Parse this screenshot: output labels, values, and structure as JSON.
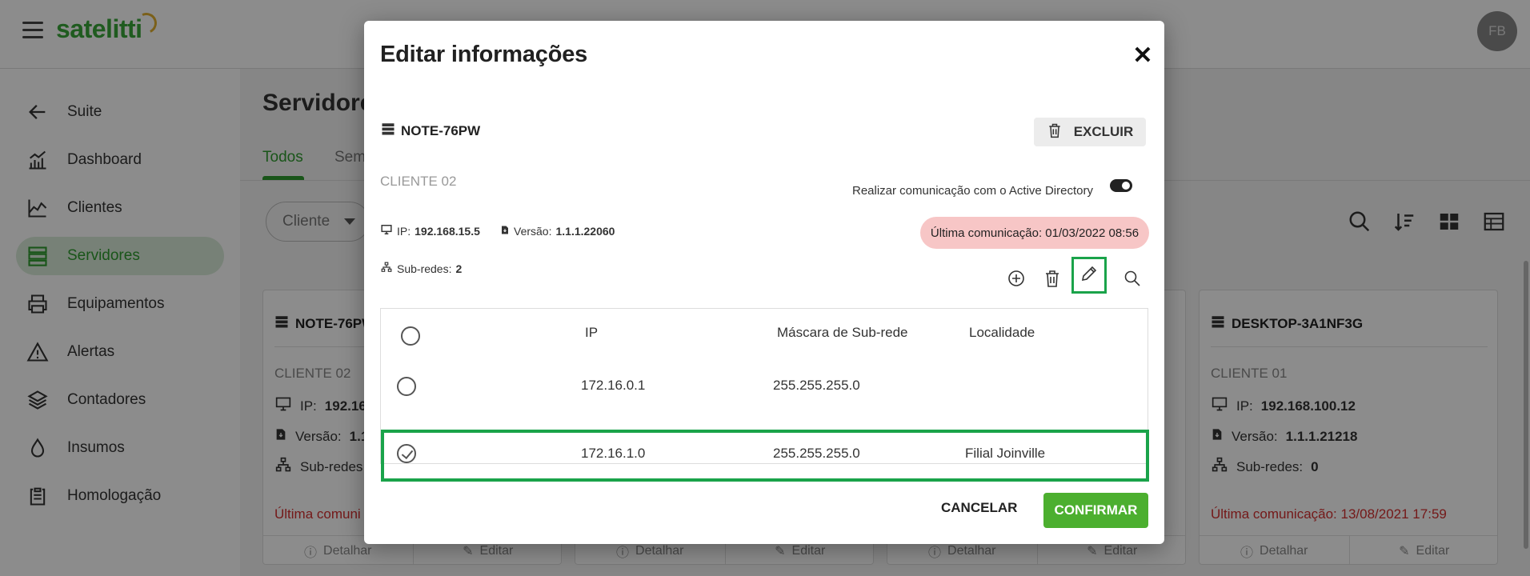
{
  "app": {
    "logo": "satelitti",
    "avatar_initials": "FB"
  },
  "sidebar": {
    "items": [
      {
        "label": "Suite",
        "icon": "arrow-left-icon"
      },
      {
        "label": "Dashboard",
        "icon": "dashboard-icon"
      },
      {
        "label": "Clientes",
        "icon": "chart-icon"
      },
      {
        "label": "Servidores",
        "icon": "server-icon",
        "active": true
      },
      {
        "label": "Equipamentos",
        "icon": "printer-icon"
      },
      {
        "label": "Alertas",
        "icon": "warning-icon"
      },
      {
        "label": "Contadores",
        "icon": "layers-icon"
      },
      {
        "label": "Insumos",
        "icon": "drop-icon"
      },
      {
        "label": "Homologação",
        "icon": "clipboard-icon"
      }
    ]
  },
  "main": {
    "title": "Servidore",
    "tabs": [
      "Todos",
      "Sem"
    ],
    "filter": {
      "label": "Cliente"
    },
    "cards": [
      {
        "name": "NOTE-76PW",
        "client": "CLIENTE 02",
        "ip_label": "IP:",
        "ip": "192.16",
        "version_label": "Versão:",
        "version": "1.1",
        "subnets_label": "Sub-redes",
        "last_comm": "Última comuni",
        "detail": "Detalhar",
        "edit": "Editar"
      },
      {
        "detail": "Detalhar",
        "edit": "Editar"
      },
      {
        "detail": "Detalhar",
        "edit": "Editar"
      },
      {
        "name": "DESKTOP-3A1NF3G",
        "client": "CLIENTE 01",
        "ip_label": "IP:",
        "ip": "192.168.100.12",
        "version_label": "Versão:",
        "version": "1.1.1.21218",
        "subnets_label": "Sub-redes:",
        "subnets": "0",
        "last_comm": "Última comunicação: 13/08/2021 17:59",
        "detail": "Detalhar",
        "edit": "Editar"
      }
    ]
  },
  "modal": {
    "title": "Editar informações",
    "server_name": "NOTE-76PW",
    "delete_label": "EXCLUIR",
    "client": "CLIENTE 02",
    "ad_label": "Realizar comunicação com o Active Directory",
    "ad_enabled": true,
    "ip_label": "IP:",
    "ip": "192.168.15.5",
    "version_label": "Versão:",
    "version": "1.1.1.22060",
    "last_comm": "Última comunicação: 01/03/2022 08:56",
    "subnets_label": "Sub-redes:",
    "subnets_count": "2",
    "table": {
      "headers": [
        "IP",
        "Máscara de Sub-rede",
        "Localidade"
      ],
      "rows": [
        {
          "ip": "172.16.0.1",
          "mask": "255.255.255.0",
          "location": "",
          "selected": false
        },
        {
          "ip": "172.16.1.0",
          "mask": "255.255.255.0",
          "location": "Filial Joinville",
          "selected": true
        }
      ]
    },
    "cancel_label": "CANCELAR",
    "confirm_label": "CONFIRMAR",
    "colors": {
      "accent": "#2e9b2e",
      "highlight": "#1aa34a",
      "confirm": "#4caf2f",
      "last_comm_bg": "#f7c6c6",
      "error": "#d32f2f"
    }
  }
}
